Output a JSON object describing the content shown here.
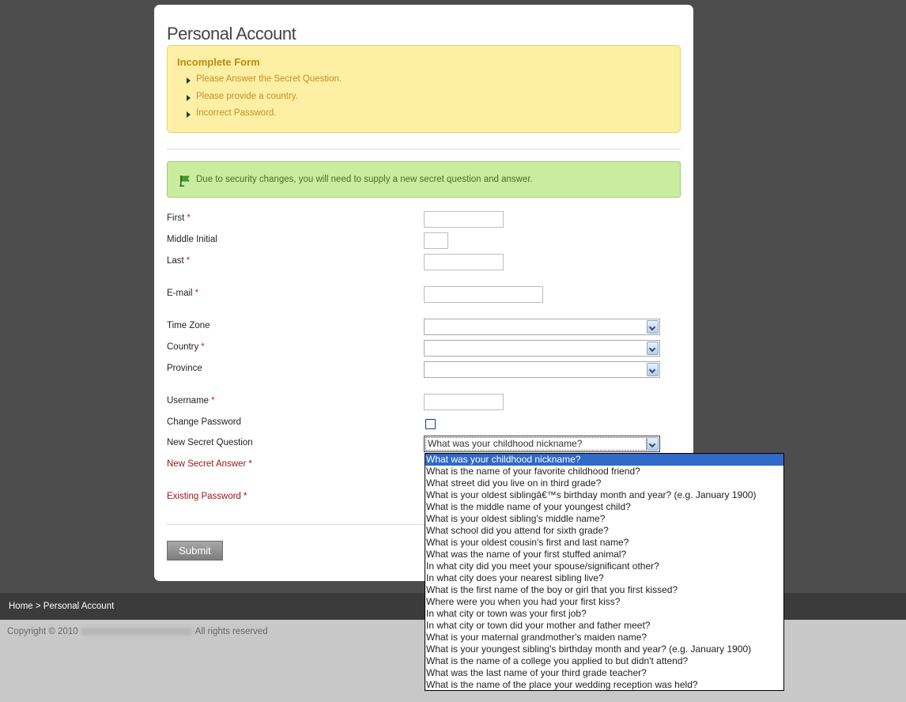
{
  "page": {
    "title": "Personal Account"
  },
  "error_box": {
    "title": "Incomplete Form",
    "items": [
      "Please Answer the Secret Question.",
      "Please provide a country.",
      "Incorrect Password."
    ]
  },
  "info_box": {
    "icon": "flag-icon",
    "text": "Due to security changes, you will need to supply a new secret question and answer."
  },
  "form": {
    "required_mark": "*",
    "first": {
      "label": "First",
      "value": ""
    },
    "middle": {
      "label": "Middle Initial",
      "value": ""
    },
    "last": {
      "label": "Last",
      "value": ""
    },
    "email": {
      "label": "E-mail",
      "value": ""
    },
    "timezone": {
      "label": "Time Zone",
      "value": ""
    },
    "country": {
      "label": "Country",
      "value": ""
    },
    "province": {
      "label": "Province",
      "value": ""
    },
    "username": {
      "label": "Username",
      "value": ""
    },
    "change_password": {
      "label": "Change Password",
      "checked": false
    },
    "secret_question": {
      "label": "New Secret Question",
      "value": "What was your childhood nickname?",
      "options": [
        "What was your childhood nickname?",
        "What is the name of your favorite childhood friend?",
        "What street did you live on in third grade?",
        "What is your oldest siblingâ€™s birthday month and year? (e.g. January 1900)",
        "What is the middle name of your youngest child?",
        "What is your oldest sibling's middle name?",
        "What school did you attend for sixth grade?",
        "What is your oldest cousin's first and last name?",
        "What was the name of your first stuffed animal?",
        "In what city did you meet your spouse/significant other?",
        "In what city does your nearest sibling live?",
        "What is the first name of the boy or girl that you first kissed?",
        "Where were you when you had your first kiss?",
        "In what city or town was your first job?",
        "In what city or town did your mother and father meet?",
        "What is your maternal grandmother's maiden name?",
        "What is your youngest sibling's birthday month and year? (e.g. January 1900)",
        "What is the name of a college you applied to but didn't attend?",
        "What was the last name of your third grade teacher?",
        "What is the name of the place your wedding reception was held?"
      ]
    },
    "secret_answer": {
      "label": "New Secret Answer"
    },
    "existing_password": {
      "label": "Existing Password"
    },
    "submit_label": "Submit"
  },
  "breadcrumb": {
    "text": "Home > Personal Account"
  },
  "footer": {
    "copyright_prefix": "Copyright © 2010",
    "copyright_suffix": "All rights reserved"
  },
  "colors": {
    "page_bg": "#4d4d4d",
    "error_bg": "#fdf0a4",
    "info_bg": "#c9ec9f",
    "selected_option": "#3169c6",
    "required": "#cc2222"
  }
}
